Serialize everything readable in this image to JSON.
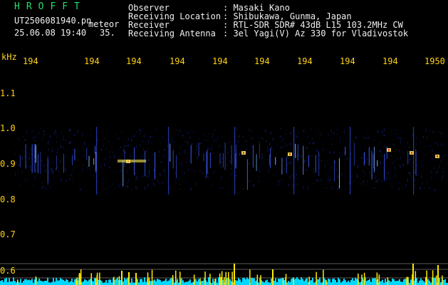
{
  "header": {
    "brand": "HROFFT",
    "filename": "UT2506081940.pn",
    "mode": "meteor",
    "date_time": "25.06.08 19:40",
    "count": "35.",
    "fields": [
      {
        "label": "Observer",
        "value": ": Masaki Kano"
      },
      {
        "label": "Receiving Location",
        "value": ": Shibukawa, Gunma, Japan"
      },
      {
        "label": "Receiver",
        "value": ": RTL-SDR SDR# 43dB L15 103.2MHz CW"
      },
      {
        "label": "Receiving Antenna",
        "value": ": 3el Yagi(V) Az 330 for Vladivostok"
      }
    ]
  },
  "axis": {
    "unit": "kHz",
    "y_ticks": [
      "1.1",
      "1.0",
      "0.9",
      "0.8",
      "0.7",
      "0.6"
    ],
    "time_ticks": [
      "194",
      "194",
      "194",
      "194",
      "194",
      "194",
      "194",
      "194",
      "194",
      "1950"
    ]
  },
  "colors": {
    "background": "#000000",
    "text": "#ffffff",
    "time_labels": "#ffd21a",
    "brand": "#22e06a",
    "signal_band": "#1b33c8",
    "echo_hot": "#ff3030",
    "level_bars": "#ffea00",
    "noise_floor": "#00d8ff"
  }
}
